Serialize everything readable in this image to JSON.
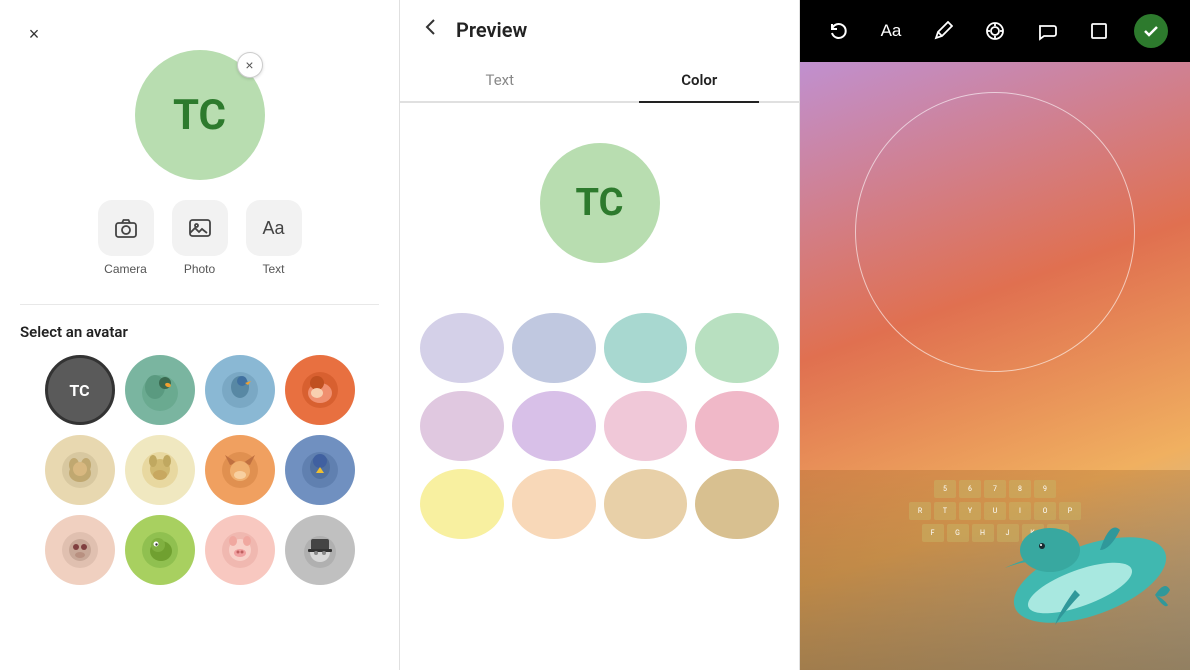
{
  "left_panel": {
    "close_label": "×",
    "avatar_initials": "TC",
    "remove_label": "×",
    "action_buttons": [
      {
        "id": "camera",
        "label": "Camera",
        "icon": "📷"
      },
      {
        "id": "photo",
        "label": "Photo",
        "icon": "🖼"
      },
      {
        "id": "text",
        "label": "Text",
        "icon": "Aa"
      }
    ],
    "section_title": "Select an avatar",
    "avatars": [
      {
        "id": "tc",
        "class": "av-tc",
        "text": "TC",
        "selected": true
      },
      {
        "id": "duck",
        "class": "av-duck",
        "text": ""
      },
      {
        "id": "bird-blue",
        "class": "av-bird-blue",
        "text": ""
      },
      {
        "id": "fox-orange",
        "class": "av-fox-orange",
        "text": ""
      },
      {
        "id": "dog",
        "class": "av-dog",
        "text": ""
      },
      {
        "id": "dog2",
        "class": "av-dog2",
        "text": ""
      },
      {
        "id": "fox2",
        "class": "av-fox2",
        "text": ""
      },
      {
        "id": "parrot",
        "class": "av-parrot",
        "text": ""
      },
      {
        "id": "sloth",
        "class": "av-sloth",
        "text": ""
      },
      {
        "id": "dino",
        "class": "av-dino",
        "text": ""
      },
      {
        "id": "pig",
        "class": "av-pig",
        "text": ""
      },
      {
        "id": "dog3",
        "class": "av-dog3",
        "text": ""
      }
    ]
  },
  "middle_panel": {
    "back_label": "←",
    "title": "Preview",
    "tabs": [
      {
        "id": "text",
        "label": "Text",
        "active": false
      },
      {
        "id": "color",
        "label": "Color",
        "active": true
      }
    ],
    "preview_initials": "TC",
    "color_swatches": [
      [
        {
          "id": "lavender",
          "class": "sw-lavender"
        },
        {
          "id": "periwinkle",
          "class": "sw-periwinkle"
        },
        {
          "id": "teal-light",
          "class": "sw-teal-light"
        },
        {
          "id": "mint",
          "class": "sw-mint"
        }
      ],
      [
        {
          "id": "lilac",
          "class": "sw-lilac"
        },
        {
          "id": "purple-light",
          "class": "sw-purple-light"
        },
        {
          "id": "pink-light",
          "class": "sw-pink-light"
        },
        {
          "id": "rose",
          "class": "sw-rose"
        }
      ],
      [
        {
          "id": "yellow",
          "class": "sw-yellow"
        },
        {
          "id": "peach",
          "class": "sw-peach"
        },
        {
          "id": "sand",
          "class": "sw-sand"
        },
        {
          "id": "tan",
          "class": "sw-tan"
        }
      ]
    ]
  },
  "right_panel": {
    "toolbar": {
      "undo_label": "↺",
      "text_label": "Aa",
      "pen_label": "✏",
      "target_label": "⊕",
      "bubble_label": "💬",
      "crop_label": "⊡",
      "check_label": "✓"
    }
  }
}
